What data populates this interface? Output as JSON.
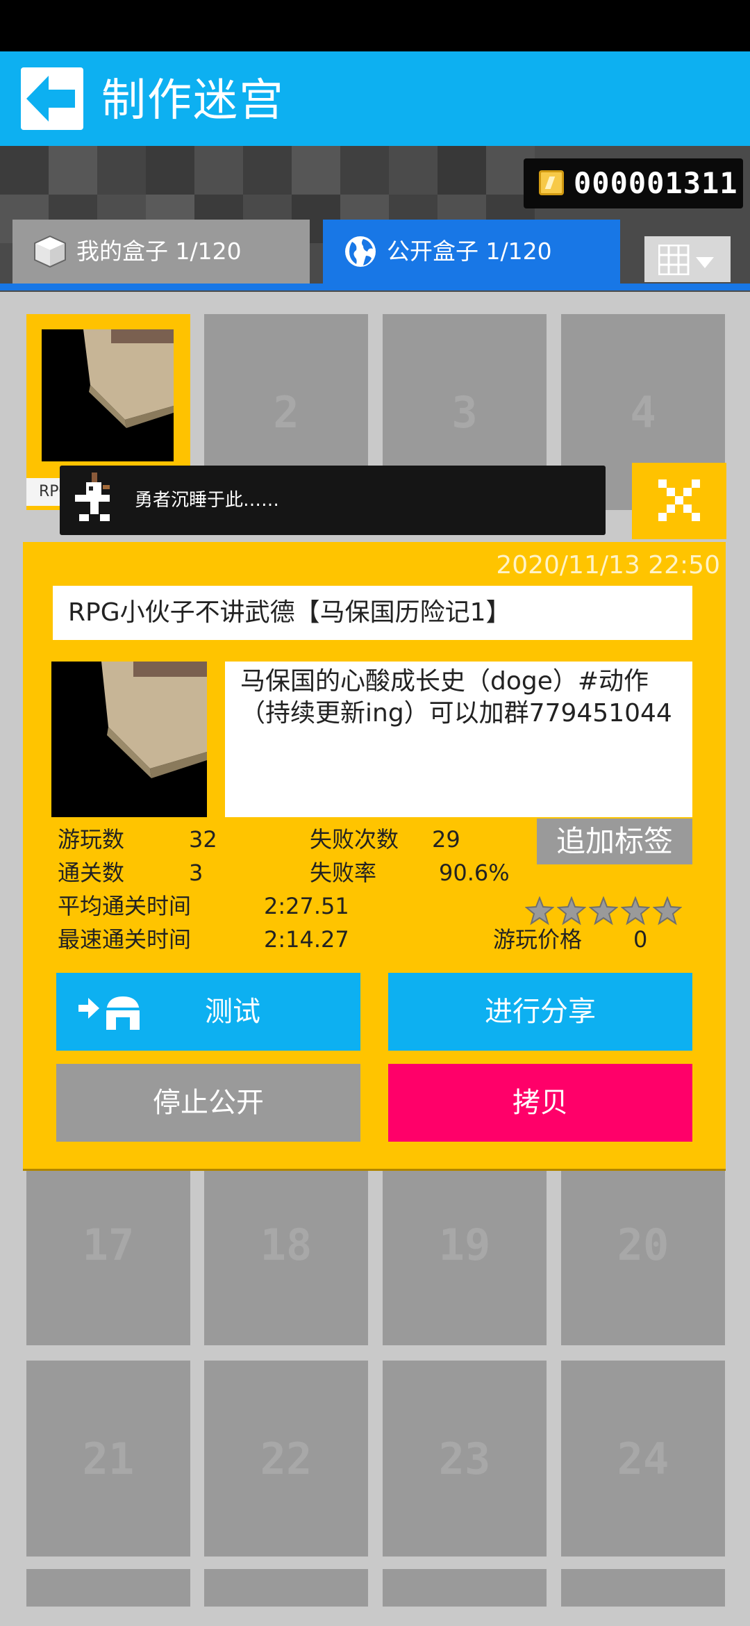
{
  "header": {
    "title": "制作迷宫"
  },
  "coins": {
    "value": "000001311"
  },
  "tabs": {
    "my_boxes": "我的盒子 1/120",
    "public_boxes": "公开盒子 1/120"
  },
  "grid": {
    "cells": [
      "2",
      "3",
      "4",
      "17",
      "18",
      "19",
      "20",
      "21",
      "22",
      "23",
      "24"
    ],
    "cell1_label": "RPG小伙子"
  },
  "bubble": {
    "text": "勇者沉睡于此……"
  },
  "dialog": {
    "date": "2020/11/13 22:50",
    "title": "RPG小伙子不讲武德【马保国历险记1】",
    "description": "马保国的心酸成长史（doge）#动作（持续更新ing）可以加群779451044",
    "add_tag": "追加标签",
    "stats": {
      "plays_label": "游玩数",
      "plays_value": "32",
      "fails_label": "失败次数",
      "fails_value": "29",
      "clears_label": "通关数",
      "clears_value": "3",
      "fail_rate_label": "失败率",
      "fail_rate_value": "90.6%",
      "avg_time_label": "平均通关时间",
      "avg_time_value": "2:27.51",
      "best_time_label": "最速通关时间",
      "best_time_value": "2:14.27",
      "price_label": "游玩价格",
      "price_value": "0"
    },
    "rating": {
      "stars_filled": 0,
      "stars_total": 5
    },
    "buttons": {
      "test": "测试",
      "share": "进行分享",
      "stop_public": "停止公开",
      "copy": "拷贝"
    }
  },
  "colors": {
    "header": "#0db0f1",
    "tab_active": "#1877e6",
    "dialog": "#ffc400",
    "copy_button": "#ff0069"
  }
}
